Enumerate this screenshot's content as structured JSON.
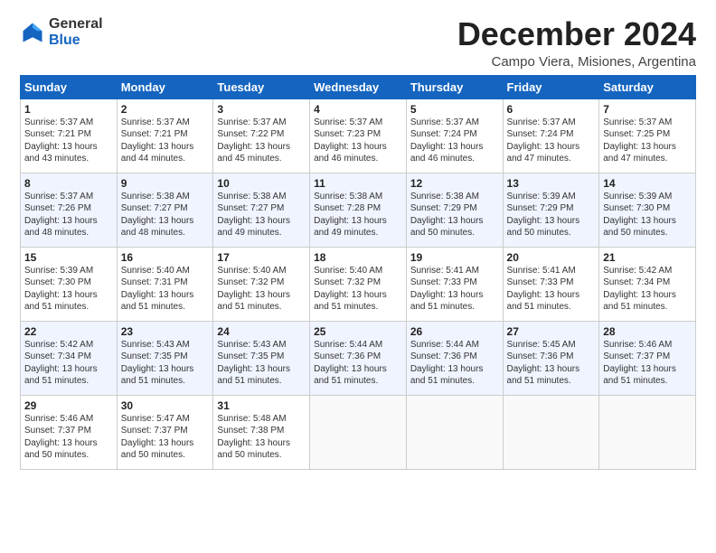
{
  "logo": {
    "line1": "General",
    "line2": "Blue"
  },
  "header": {
    "month": "December 2024",
    "location": "Campo Viera, Misiones, Argentina"
  },
  "days_of_week": [
    "Sunday",
    "Monday",
    "Tuesday",
    "Wednesday",
    "Thursday",
    "Friday",
    "Saturday"
  ],
  "weeks": [
    [
      {
        "day": 1,
        "lines": [
          "Sunrise: 5:37 AM",
          "Sunset: 7:21 PM",
          "Daylight: 13 hours",
          "and 43 minutes."
        ]
      },
      {
        "day": 2,
        "lines": [
          "Sunrise: 5:37 AM",
          "Sunset: 7:21 PM",
          "Daylight: 13 hours",
          "and 44 minutes."
        ]
      },
      {
        "day": 3,
        "lines": [
          "Sunrise: 5:37 AM",
          "Sunset: 7:22 PM",
          "Daylight: 13 hours",
          "and 45 minutes."
        ]
      },
      {
        "day": 4,
        "lines": [
          "Sunrise: 5:37 AM",
          "Sunset: 7:23 PM",
          "Daylight: 13 hours",
          "and 46 minutes."
        ]
      },
      {
        "day": 5,
        "lines": [
          "Sunrise: 5:37 AM",
          "Sunset: 7:24 PM",
          "Daylight: 13 hours",
          "and 46 minutes."
        ]
      },
      {
        "day": 6,
        "lines": [
          "Sunrise: 5:37 AM",
          "Sunset: 7:24 PM",
          "Daylight: 13 hours",
          "and 47 minutes."
        ]
      },
      {
        "day": 7,
        "lines": [
          "Sunrise: 5:37 AM",
          "Sunset: 7:25 PM",
          "Daylight: 13 hours",
          "and 47 minutes."
        ]
      }
    ],
    [
      {
        "day": 8,
        "lines": [
          "Sunrise: 5:37 AM",
          "Sunset: 7:26 PM",
          "Daylight: 13 hours",
          "and 48 minutes."
        ]
      },
      {
        "day": 9,
        "lines": [
          "Sunrise: 5:38 AM",
          "Sunset: 7:27 PM",
          "Daylight: 13 hours",
          "and 48 minutes."
        ]
      },
      {
        "day": 10,
        "lines": [
          "Sunrise: 5:38 AM",
          "Sunset: 7:27 PM",
          "Daylight: 13 hours",
          "and 49 minutes."
        ]
      },
      {
        "day": 11,
        "lines": [
          "Sunrise: 5:38 AM",
          "Sunset: 7:28 PM",
          "Daylight: 13 hours",
          "and 49 minutes."
        ]
      },
      {
        "day": 12,
        "lines": [
          "Sunrise: 5:38 AM",
          "Sunset: 7:29 PM",
          "Daylight: 13 hours",
          "and 50 minutes."
        ]
      },
      {
        "day": 13,
        "lines": [
          "Sunrise: 5:39 AM",
          "Sunset: 7:29 PM",
          "Daylight: 13 hours",
          "and 50 minutes."
        ]
      },
      {
        "day": 14,
        "lines": [
          "Sunrise: 5:39 AM",
          "Sunset: 7:30 PM",
          "Daylight: 13 hours",
          "and 50 minutes."
        ]
      }
    ],
    [
      {
        "day": 15,
        "lines": [
          "Sunrise: 5:39 AM",
          "Sunset: 7:30 PM",
          "Daylight: 13 hours",
          "and 51 minutes."
        ]
      },
      {
        "day": 16,
        "lines": [
          "Sunrise: 5:40 AM",
          "Sunset: 7:31 PM",
          "Daylight: 13 hours",
          "and 51 minutes."
        ]
      },
      {
        "day": 17,
        "lines": [
          "Sunrise: 5:40 AM",
          "Sunset: 7:32 PM",
          "Daylight: 13 hours",
          "and 51 minutes."
        ]
      },
      {
        "day": 18,
        "lines": [
          "Sunrise: 5:40 AM",
          "Sunset: 7:32 PM",
          "Daylight: 13 hours",
          "and 51 minutes."
        ]
      },
      {
        "day": 19,
        "lines": [
          "Sunrise: 5:41 AM",
          "Sunset: 7:33 PM",
          "Daylight: 13 hours",
          "and 51 minutes."
        ]
      },
      {
        "day": 20,
        "lines": [
          "Sunrise: 5:41 AM",
          "Sunset: 7:33 PM",
          "Daylight: 13 hours",
          "and 51 minutes."
        ]
      },
      {
        "day": 21,
        "lines": [
          "Sunrise: 5:42 AM",
          "Sunset: 7:34 PM",
          "Daylight: 13 hours",
          "and 51 minutes."
        ]
      }
    ],
    [
      {
        "day": 22,
        "lines": [
          "Sunrise: 5:42 AM",
          "Sunset: 7:34 PM",
          "Daylight: 13 hours",
          "and 51 minutes."
        ]
      },
      {
        "day": 23,
        "lines": [
          "Sunrise: 5:43 AM",
          "Sunset: 7:35 PM",
          "Daylight: 13 hours",
          "and 51 minutes."
        ]
      },
      {
        "day": 24,
        "lines": [
          "Sunrise: 5:43 AM",
          "Sunset: 7:35 PM",
          "Daylight: 13 hours",
          "and 51 minutes."
        ]
      },
      {
        "day": 25,
        "lines": [
          "Sunrise: 5:44 AM",
          "Sunset: 7:36 PM",
          "Daylight: 13 hours",
          "and 51 minutes."
        ]
      },
      {
        "day": 26,
        "lines": [
          "Sunrise: 5:44 AM",
          "Sunset: 7:36 PM",
          "Daylight: 13 hours",
          "and 51 minutes."
        ]
      },
      {
        "day": 27,
        "lines": [
          "Sunrise: 5:45 AM",
          "Sunset: 7:36 PM",
          "Daylight: 13 hours",
          "and 51 minutes."
        ]
      },
      {
        "day": 28,
        "lines": [
          "Sunrise: 5:46 AM",
          "Sunset: 7:37 PM",
          "Daylight: 13 hours",
          "and 51 minutes."
        ]
      }
    ],
    [
      {
        "day": 29,
        "lines": [
          "Sunrise: 5:46 AM",
          "Sunset: 7:37 PM",
          "Daylight: 13 hours",
          "and 50 minutes."
        ]
      },
      {
        "day": 30,
        "lines": [
          "Sunrise: 5:47 AM",
          "Sunset: 7:37 PM",
          "Daylight: 13 hours",
          "and 50 minutes."
        ]
      },
      {
        "day": 31,
        "lines": [
          "Sunrise: 5:48 AM",
          "Sunset: 7:38 PM",
          "Daylight: 13 hours",
          "and 50 minutes."
        ]
      },
      null,
      null,
      null,
      null
    ]
  ]
}
